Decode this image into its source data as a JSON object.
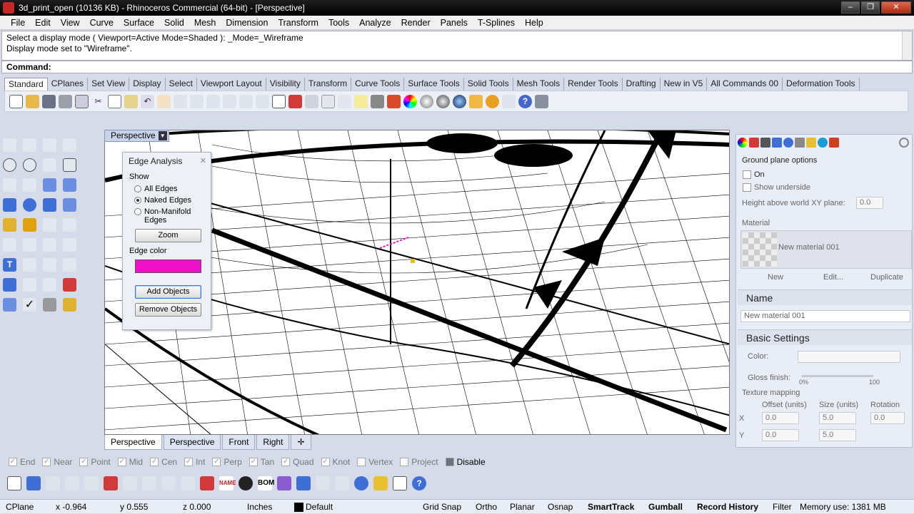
{
  "window": {
    "title": "3d_print_open (10136 KB) - Rhinoceros Commercial (64-bit) - [Perspective]"
  },
  "menu": [
    "File",
    "Edit",
    "View",
    "Curve",
    "Surface",
    "Solid",
    "Mesh",
    "Dimension",
    "Transform",
    "Tools",
    "Analyze",
    "Render",
    "Panels",
    "T-Splines",
    "Help"
  ],
  "command": {
    "history": [
      "Select a display mode ( Viewport=Active  Mode=Shaded ): _Mode=_Wireframe",
      "Display mode set to \"Wireframe\"."
    ],
    "prompt": "Command:"
  },
  "toolbar_tabs": [
    "Standard",
    "CPlanes",
    "Set View",
    "Display",
    "Select",
    "Viewport Layout",
    "Visibility",
    "Transform",
    "Curve Tools",
    "Surface Tools",
    "Solid Tools",
    "Mesh Tools",
    "Render Tools",
    "Drafting",
    "New in V5",
    "All Commands 00",
    "Deformation Tools"
  ],
  "viewport": {
    "label": "Perspective"
  },
  "edge_analysis": {
    "title": "Edge Analysis",
    "show_label": "Show",
    "options": [
      "All Edges",
      "Naked Edges",
      "Non-Manifold Edges"
    ],
    "selected": "Naked Edges",
    "zoom": "Zoom",
    "edge_color_label": "Edge color",
    "edge_color": "#ee11cc",
    "add_objects": "Add Objects",
    "remove_objects": "Remove Objects"
  },
  "viewport_tabs": [
    "Perspective",
    "Perspective",
    "Front",
    "Right"
  ],
  "properties": {
    "ground_plane": "Ground plane options",
    "on": "On",
    "show_underside": "Show underside",
    "height_label": "Height above world XY plane:",
    "height_value": "0.0",
    "material_label": "Material",
    "material_name": "New material 001",
    "new": "New",
    "edit": "Edit...",
    "duplicate": "Duplicate",
    "name_header": "Name",
    "name_value": "New material 001",
    "basic_settings": "Basic Settings",
    "color": "Color:",
    "gloss": "Gloss finish:",
    "gloss_min": "0%",
    "gloss_max": "100",
    "texture_mapping": "Texture mapping",
    "offset": "Offset (units)",
    "size": "Size (units)",
    "rotation": "Rotation",
    "offset_x": "0.0",
    "offset_y": "0.0",
    "size_x": "5.0",
    "size_y": "5.0",
    "rotation_value": "0.0",
    "x": "X",
    "y": "Y"
  },
  "osnaps": [
    "End",
    "Near",
    "Point",
    "Mid",
    "Cen",
    "Int",
    "Perp",
    "Tan",
    "Quad",
    "Knot",
    "Vertex",
    "Project"
  ],
  "osnap_checked": [
    true,
    true,
    true,
    true,
    true,
    true,
    true,
    true,
    true,
    true,
    false,
    false
  ],
  "osnap_disable": "Disable",
  "status": {
    "cplane": "CPlane",
    "x": "x -0.964",
    "y": "y 0.555",
    "z": "z 0.000",
    "units": "Inches",
    "layer": "Default",
    "grid_snap": "Grid Snap",
    "ortho": "Ortho",
    "planar": "Planar",
    "osnap": "Osnap",
    "smarttrack": "SmartTrack",
    "gumball": "Gumball",
    "record_history": "Record History",
    "filter": "Filter",
    "memory": "Memory use: 1381 MB"
  }
}
